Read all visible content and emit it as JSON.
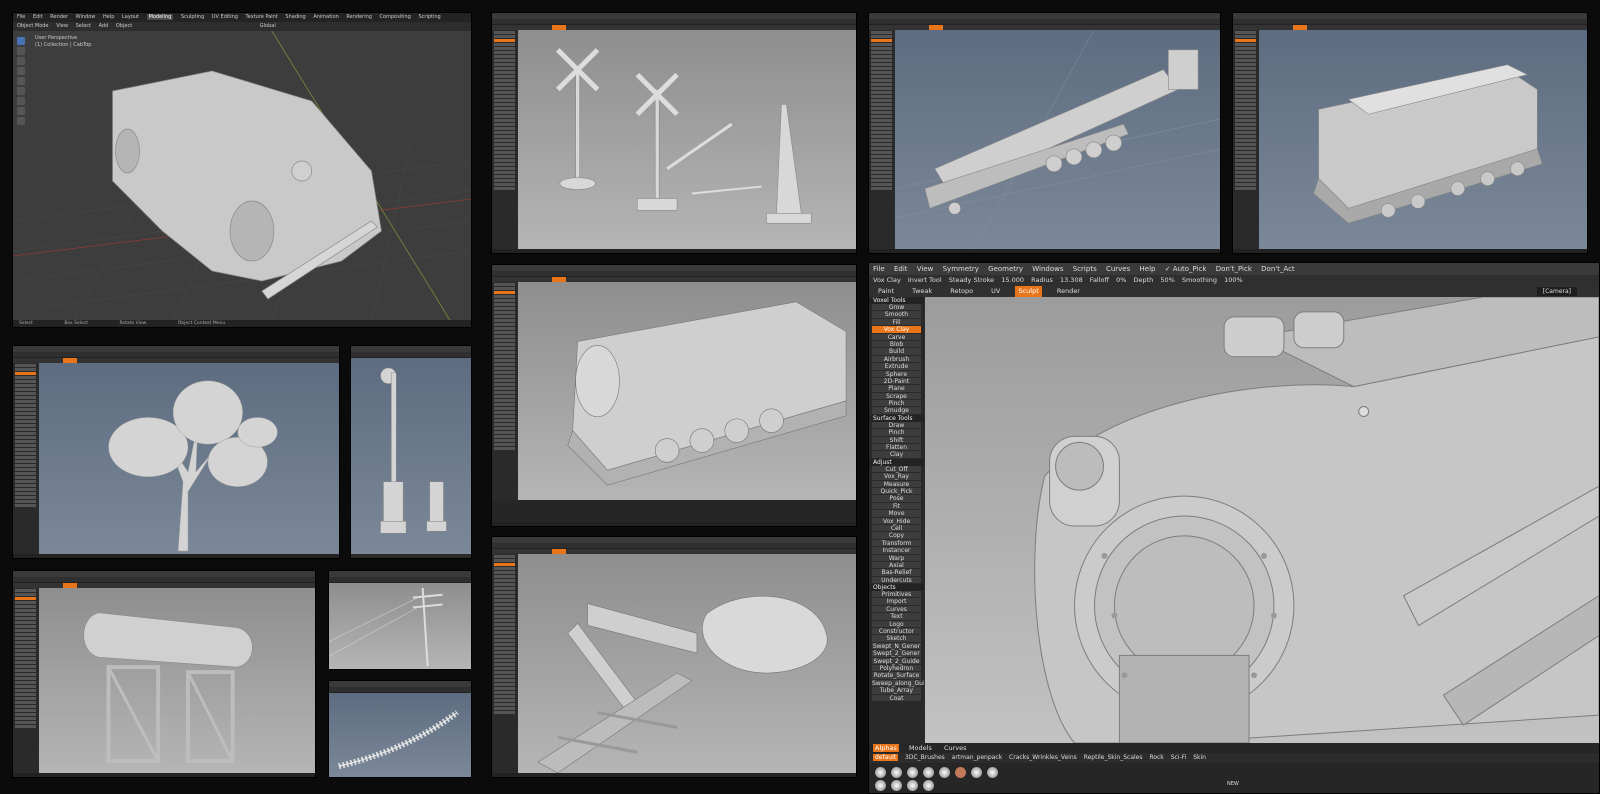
{
  "colors": {
    "accent": "#e8751a",
    "blender_bg": "#3d3d3d",
    "sculpt_grey": "#b0b0b0",
    "blue_bg": "#6c7a8c"
  },
  "blender": {
    "menus": [
      "File",
      "Edit",
      "Render",
      "Window",
      "Help",
      "Layout",
      "Modeling",
      "Sculpting",
      "UV Editing",
      "Texture Paint",
      "Shading",
      "Animation",
      "Rendering",
      "Compositing",
      "Scripting"
    ],
    "active_workspace": "Modeling",
    "tool_items": [
      "Object Mode",
      "View",
      "Select",
      "Add",
      "Object"
    ],
    "orientation": "Global",
    "view_label": "User Perspective",
    "collection_label": "(1) Collection | CabTop",
    "status_items": [
      "Select",
      "Box Select",
      "Rotate View",
      "Object Context Menu"
    ]
  },
  "main": {
    "menus": [
      "File",
      "Edit",
      "View",
      "Symmetry",
      "Geometry",
      "Windows",
      "Scripts",
      "Curves",
      "Help",
      "✓ Auto_Pick",
      "Don't_Pick",
      "Don't_Act"
    ],
    "toolbar": {
      "tool": "Vox Clay",
      "invert": "Invert Tool",
      "steady": "Steady Stroke",
      "steady_val": "15.000",
      "radius": "Radius",
      "radius_val": "13.308",
      "falloff": "Falloff",
      "falloff_val": "0%",
      "depth": "Depth",
      "depth_val": "50%",
      "smoothing": "Smoothing",
      "smoothing_val": "100%"
    },
    "rooms": [
      "Paint",
      "Tweak",
      "Retopo",
      "UV",
      "Sculpt",
      "Render"
    ],
    "active_room": "Sculpt",
    "camera": "[Camera]",
    "voxel_header": "Voxel Tools",
    "voxel_tools": [
      "Grow",
      "Smooth",
      "Fill",
      "Vox Clay",
      "Carve",
      "Blob",
      "Build",
      "Airbrush",
      "Extrude",
      "Sphere",
      "2D-Paint",
      "Plane",
      "Scrape",
      "Pinch",
      "Smudge"
    ],
    "surface_header": "Surface Tools",
    "surface_tools": [
      "Draw",
      "Pinch",
      "Shift",
      "Flatten",
      "Clay"
    ],
    "adjust_header": "Adjust",
    "adjust_tools": [
      "Cut_Off",
      "Vox_Ray",
      "Measure",
      "Quick_Pick",
      "Pose",
      "Fit",
      "Move",
      "Vox_Hide",
      "Cell",
      "Copy",
      "Transform",
      "Instancer",
      "Warp",
      "Axial",
      "Bas-Relief",
      "Undercuts"
    ],
    "objects_header": "Objects",
    "objects_tools": [
      "Primitives",
      "Import",
      "Curves",
      "Text",
      "Logo",
      "Constructor",
      "Sketch",
      "Swept_N_Gener",
      "Swept_2_Gener",
      "Swept_2_Guide",
      "Polyhedron",
      "Rotate_Surface",
      "Sweep_along_Guide",
      "Tube_Array",
      "Coat"
    ],
    "bottom_tabs": [
      "Alphas",
      "Models",
      "Curves"
    ],
    "active_bottom_tab": "Alphas",
    "alpha_sets": [
      "default",
      "3DC_Brushes",
      "artman_penpack",
      "Cracks_Wrinkles_Veins",
      "Reptile_Skin_Scales",
      "Rock",
      "Sci-Fi",
      "Skin"
    ],
    "active_alpha_set": "default",
    "new_label": "NEW"
  }
}
